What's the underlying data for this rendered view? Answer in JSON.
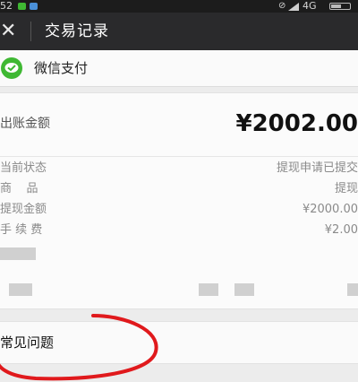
{
  "status_bar": {
    "time": "52",
    "network": "4G",
    "battery_level": 0.5,
    "colors": {
      "wechat_icon": "#3fb833",
      "message_icon": "#4a90d9"
    }
  },
  "nav": {
    "close_icon": "close-icon",
    "title": "交易记录"
  },
  "payment": {
    "logo_icon": "wechat-pay-icon",
    "provider": "微信支付"
  },
  "amount": {
    "label": "出账金额",
    "value": "¥2002.00"
  },
  "details": [
    {
      "key": "当前状态",
      "value": "提现申请已提交"
    },
    {
      "key": "商    品",
      "value": "提现"
    },
    {
      "key": "提现金额",
      "value": "¥2000.00"
    },
    {
      "key": "手 续 费",
      "value": "¥2.00"
    }
  ],
  "faq": {
    "label": "常见问题",
    "annotation_color": "#e0191c"
  },
  "colors": {
    "nav_background": "#2a2a2c",
    "page_background": "#ececec",
    "accent_green": "#3fb833"
  }
}
